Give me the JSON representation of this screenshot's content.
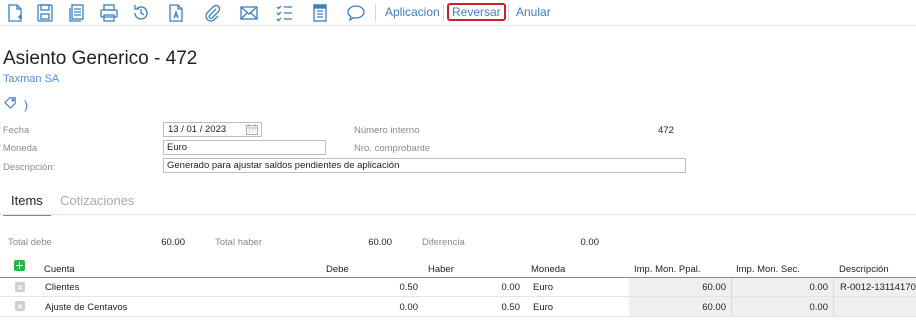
{
  "toolbar": {
    "icons": [
      "new-document-icon",
      "save-icon",
      "copy-icon",
      "print-icon",
      "history-icon",
      "attachment-document-icon",
      "paperclip-icon",
      "email-icon",
      "checklist-icon",
      "notebook-icon",
      "comment-icon"
    ],
    "actions": {
      "aplicacion": "Aplicacion",
      "reversar": "Reversar",
      "anular": "Anular"
    },
    "icon_color": "#3a7fc1",
    "highlight_color": "#c8202c"
  },
  "header": {
    "title": "Asiento Generico - 472",
    "company": "Taxman SA",
    "tag_paren": ")"
  },
  "form": {
    "fecha_label": "Fecha",
    "fecha_day": "13",
    "fecha_month": "01",
    "fecha_year": "2023",
    "moneda_label": "Moneda",
    "moneda_value": "Euro",
    "descripcion_label": "Descripción:",
    "descripcion_value": "Generado para ajustar saldos pendientes de aplicación",
    "numero_interno_label": "Número interno",
    "numero_interno_value": "472",
    "nro_comprobante_label": "Nro. comprobante",
    "nro_comprobante_value": ""
  },
  "tabs": [
    "Items",
    "Cotizaciones"
  ],
  "totals": {
    "total_debe_label": "Total debe",
    "total_debe_value": "60.00",
    "total_haber_label": "Total haber",
    "total_haber_value": "60.00",
    "diferencia_label": "Diferencia",
    "diferencia_value": "0.00"
  },
  "table": {
    "headers": {
      "cuenta": "Cuenta",
      "debe": "Debe",
      "haber": "Haber",
      "moneda": "Moneda",
      "imp_ppal": "Imp. Mon. Ppal.",
      "imp_sec": "Imp. Mon. Sec.",
      "descripcion": "Descripción"
    },
    "rows": [
      {
        "cuenta": "Clientes",
        "debe": "0.50",
        "haber": "0.00",
        "moneda": "Euro",
        "imp_ppal": "60.00",
        "imp_sec": "0.00",
        "descripcion": "R-0012-13114170"
      },
      {
        "cuenta": "Ajuste de Centavos",
        "debe": "0.00",
        "haber": "0.50",
        "moneda": "Euro",
        "imp_ppal": "60.00",
        "imp_sec": "0.00",
        "descripcion": ""
      }
    ]
  }
}
